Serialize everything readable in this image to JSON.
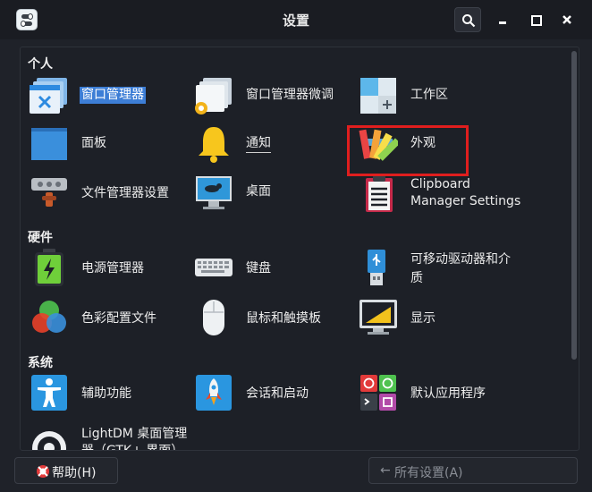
{
  "window": {
    "title": "设置"
  },
  "sections": [
    {
      "title": "个人"
    },
    {
      "title": "硬件"
    },
    {
      "title": "系统"
    }
  ],
  "items": {
    "wm": "窗口管理器",
    "wm_tweaks": "窗口管理器微调",
    "workspaces": "工作区",
    "panel": "面板",
    "notifications": "通知",
    "appearance": "外观",
    "file_manager": "文件管理器设置",
    "desktop": "桌面",
    "clipboard_line1": "Clipboard",
    "clipboard_line2": "Manager Settings",
    "power": "电源管理器",
    "keyboard": "键盘",
    "removable_line1": "可移动驱动器和介",
    "removable_line2": "质",
    "color_profiles": "色彩配置文件",
    "mouse": "鼠标和触摸板",
    "display": "显示",
    "accessibility": "辅助功能",
    "session": "会话和启动",
    "default_apps": "默认应用程序",
    "lightdm_line1": "LightDM 桌面管理",
    "lightdm_line2": "器（GTK+ 界面）"
  },
  "footer": {
    "help_label": "帮助(H)",
    "all_settings_label": "所有设置(A)"
  },
  "selected_item": "窗口管理器",
  "colors": {
    "selection": "#3d7ed6",
    "highlight_box": "#e01e1e"
  }
}
